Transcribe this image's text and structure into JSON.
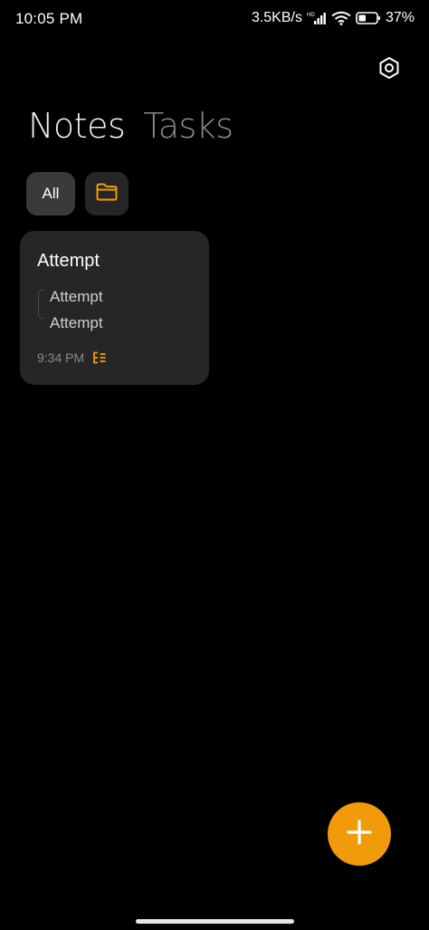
{
  "status_bar": {
    "time": "10:05 PM",
    "net_speed": "3.5KB/s",
    "hd_label": "HD",
    "battery": "37%"
  },
  "header": {
    "tab_notes": "Notes",
    "tab_tasks": "Tasks",
    "settings_icon": "gear-icon"
  },
  "filters": {
    "all_label": "All",
    "folder_icon": "folder-icon"
  },
  "notes": [
    {
      "title": "Attempt",
      "lines": [
        "Attempt",
        "Attempt"
      ],
      "time": "9:34 PM",
      "icon": "checklist-icon"
    }
  ],
  "fab": {
    "icon": "plus-icon"
  },
  "colors": {
    "background": "#000000",
    "card": "#262626",
    "accent": "#f29b0a",
    "chip_active": "#3a3a3a",
    "chip_inactive": "#262626",
    "inactive_tab": "#8a8a8a"
  }
}
